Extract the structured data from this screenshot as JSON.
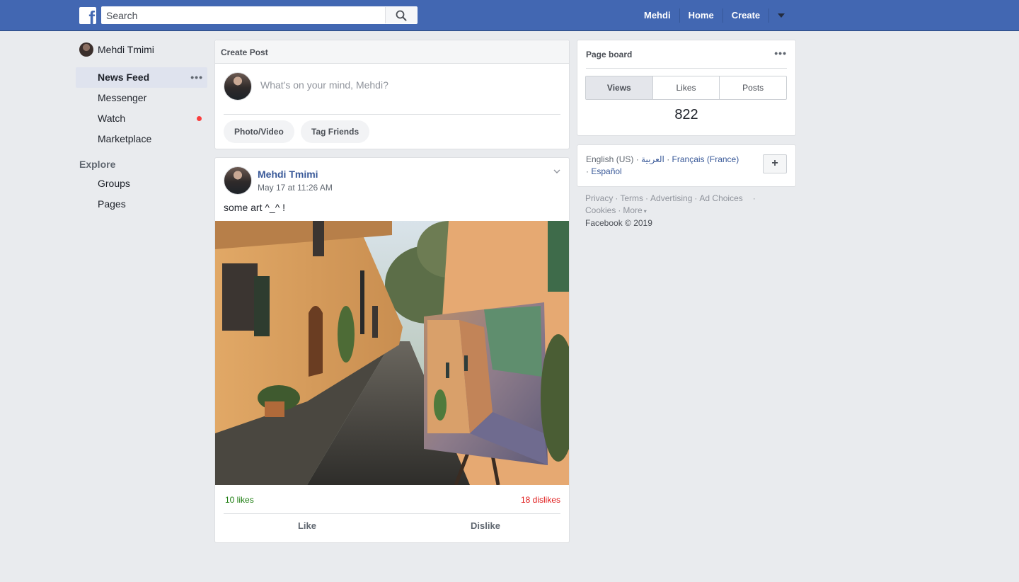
{
  "topbar": {
    "logo_letter": "f",
    "search_placeholder": "Search",
    "nav": [
      "Mehdi",
      "Home",
      "Create"
    ],
    "icons": [
      "facebook-logo-icon",
      "search-icon",
      "caret-down-icon"
    ],
    "bg_color": "#4267b2"
  },
  "sidebar": {
    "profile_name": "Mehdi Tmimi",
    "items": [
      {
        "label": "News Feed"
      },
      {
        "label": "Messenger"
      },
      {
        "label": "Watch"
      },
      {
        "label": "Marketplace"
      }
    ],
    "explore_title": "Explore",
    "explore_items": [
      {
        "label": "Groups"
      },
      {
        "label": "Pages"
      }
    ]
  },
  "create_post": {
    "title": "Create Post",
    "placeholder": "What's on your mind, Mehdi?",
    "buttons": [
      "Photo/Video",
      "Tag Friends"
    ]
  },
  "post": {
    "author": "Mehdi Tmimi",
    "time": "May 17 at 11:26 AM",
    "text": "some art ^_^ !",
    "likes": "10 likes",
    "dislikes": "18 dislikes",
    "like_action": "Like",
    "dislike_action": "Dislike",
    "likes_color": "#1c7d0f",
    "dislikes_color": "#e01b1b"
  },
  "page_board": {
    "title": "Page board",
    "tabs": [
      "Views",
      "Likes",
      "Posts"
    ],
    "active_tab": "Views",
    "value": "822"
  },
  "languages": {
    "current": "English (US)",
    "others": [
      "العربية",
      "Français (France)",
      "Español"
    ],
    "add_label": "+"
  },
  "footer": {
    "links": [
      "Privacy",
      "Terms",
      "Advertising",
      "Ad Choices",
      "Cookies",
      "More"
    ],
    "copyright": "Facebook © 2019"
  }
}
